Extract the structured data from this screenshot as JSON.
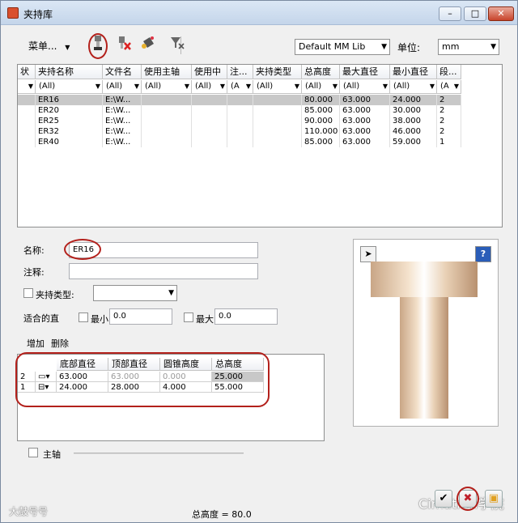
{
  "window": {
    "title": "夹持库"
  },
  "toolbar": {
    "menu_label": "菜单...",
    "library_select": "Default MM Lib",
    "unit_label": "单位:",
    "unit_select": "mm"
  },
  "grid": {
    "headers": [
      "状",
      "夹持名称",
      "文件名",
      "使用主轴",
      "使用中",
      "注...",
      "夹持类型",
      "总高度",
      "最大直径",
      "最小直径",
      "段..."
    ],
    "filters": [
      "",
      "(All)",
      "(All)",
      "(All)",
      "(All)",
      "(A",
      "(All)",
      "(All)",
      "(All)",
      "(All)",
      "(A"
    ],
    "rows": [
      [
        "",
        "ER16",
        "E:\\W...",
        "",
        "",
        "",
        "",
        "80.000",
        "63.000",
        "24.000",
        "2"
      ],
      [
        "",
        "ER20",
        "E:\\W...",
        "",
        "",
        "",
        "",
        "85.000",
        "63.000",
        "30.000",
        "2"
      ],
      [
        "",
        "ER25",
        "E:\\W...",
        "",
        "",
        "",
        "",
        "90.000",
        "63.000",
        "38.000",
        "2"
      ],
      [
        "",
        "ER32",
        "E:\\W...",
        "",
        "",
        "",
        "",
        "110.000",
        "63.000",
        "46.000",
        "2"
      ],
      [
        "",
        "ER40",
        "E:\\W...",
        "",
        "",
        "",
        "",
        "85.000",
        "63.000",
        "59.000",
        "1"
      ]
    ]
  },
  "form": {
    "name_label": "名称:",
    "name_value": "ER16",
    "comment_label": "注释:",
    "comment_value": "",
    "holder_type_label": "夹持类型:",
    "fit_label": "适合的直",
    "min_label": "最小",
    "min_value": "0.0",
    "max_label": "最大",
    "max_value": "0.0",
    "add_label": "增加",
    "delete_label": "删除"
  },
  "segments": {
    "headers": [
      "底部直径",
      "顶部直径",
      "圆锥高度",
      "总高度"
    ],
    "rows": [
      {
        "index": "2",
        "bottom": "63.000",
        "top": "63.000",
        "cone": "0.000",
        "total": "25.000"
      },
      {
        "index": "1",
        "bottom": "24.000",
        "top": "28.000",
        "cone": "4.000",
        "total": "55.000"
      }
    ]
  },
  "bottom": {
    "spindle_label": "主轴",
    "total_height": "总高度 = 80.0",
    "watermark_left": "大鼓号号",
    "watermark_right": "Cimatron学院"
  },
  "icons": {
    "holder": "holder-icon",
    "delete": "delete-holder-icon",
    "paint": "paint-bucket-icon",
    "filter": "filter-clear-icon"
  },
  "colors": {
    "highlight": "#b3201b",
    "selected_row": "#c8c8c8"
  }
}
